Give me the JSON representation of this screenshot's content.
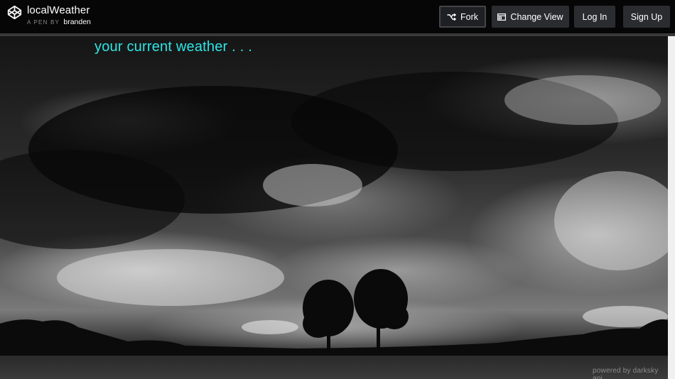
{
  "header": {
    "title": "localWeather",
    "meta_prefix": "A PEN BY",
    "author": "branden",
    "logo_icon": "codepen-logo-icon"
  },
  "toolbar": {
    "fork_label": "Fork",
    "fork_icon": "fork-icon",
    "change_view_label": "Change View",
    "change_view_icon": "layout-icon",
    "login_label": "Log In",
    "signup_label": "Sign Up"
  },
  "app": {
    "headline": "your current weather . . .",
    "credit": "powered by darksky api"
  },
  "colors": {
    "headline": "#2ee6e6",
    "topbar": "#060606",
    "button_bg": "#2b2c30"
  }
}
